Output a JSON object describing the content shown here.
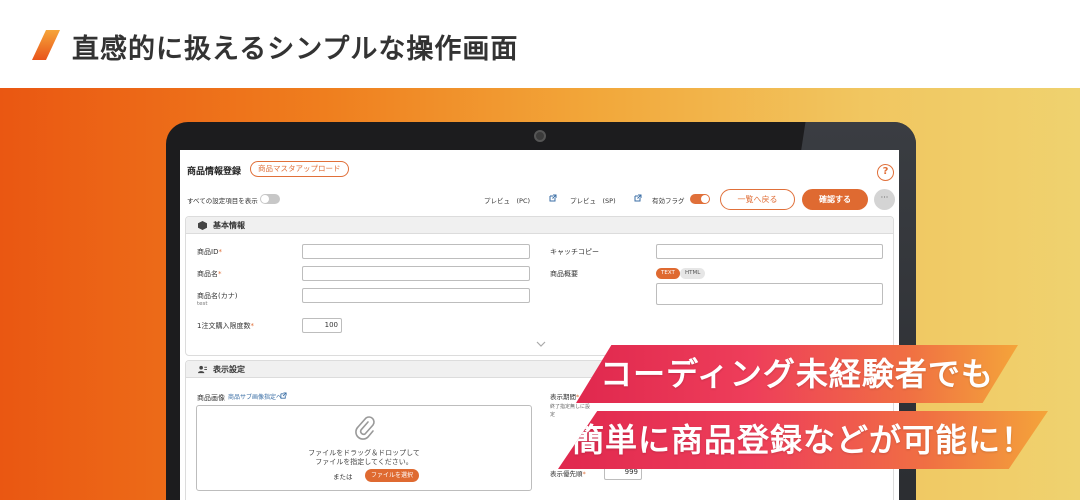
{
  "headline": "直感的に扱えるシンプルな操作画面",
  "colors": {
    "accent": "#df6a31",
    "title_slash_top": "#f6a53a",
    "title_slash_bottom": "#e9541a"
  },
  "app": {
    "page_title": "商品情報登録",
    "upload_button": "商品マスタアップロード",
    "help_icon_label": "?",
    "show_all_label": "すべての設定項目を表示",
    "preview_pc": "プレビュ　(PC)",
    "preview_sp": "プレビュ　(SP)",
    "active_flag": "有効フラグ",
    "back_button": "一覧へ戻る",
    "confirm_button": "確認する",
    "more_button": "···",
    "basic_section": {
      "title": "基本情報",
      "product_id": "商品ID",
      "product_name": "商品名",
      "product_kana": "商品名(カナ)",
      "product_kana_hint": "test",
      "max_qty": "1注文購入限度数",
      "max_qty_value": "100",
      "catch_copy": "キャッチコピー",
      "summary": "商品概要",
      "text_mode": "TEXT",
      "html_mode": "HTML"
    },
    "display_section": {
      "title": "表示設定",
      "image_label": "商品画像",
      "sub_image_link": "商品サブ画像指定へ",
      "drop_text_1": "ファイルをドラッグ＆ドロップして",
      "drop_text_2": "ファイルを指定してください。",
      "or_text": "または",
      "select_file": "ファイルを選択",
      "display_period": "表示期間",
      "display_period_note_1": "終了指定無しに設",
      "display_period_note_2": "定",
      "display_sort": "表示優先順",
      "display_sort_value": "999"
    },
    "required_mark": "*"
  },
  "banners": {
    "line1": "コーディング未経験者でも",
    "line2": "簡単に商品登録などが可能に！"
  }
}
